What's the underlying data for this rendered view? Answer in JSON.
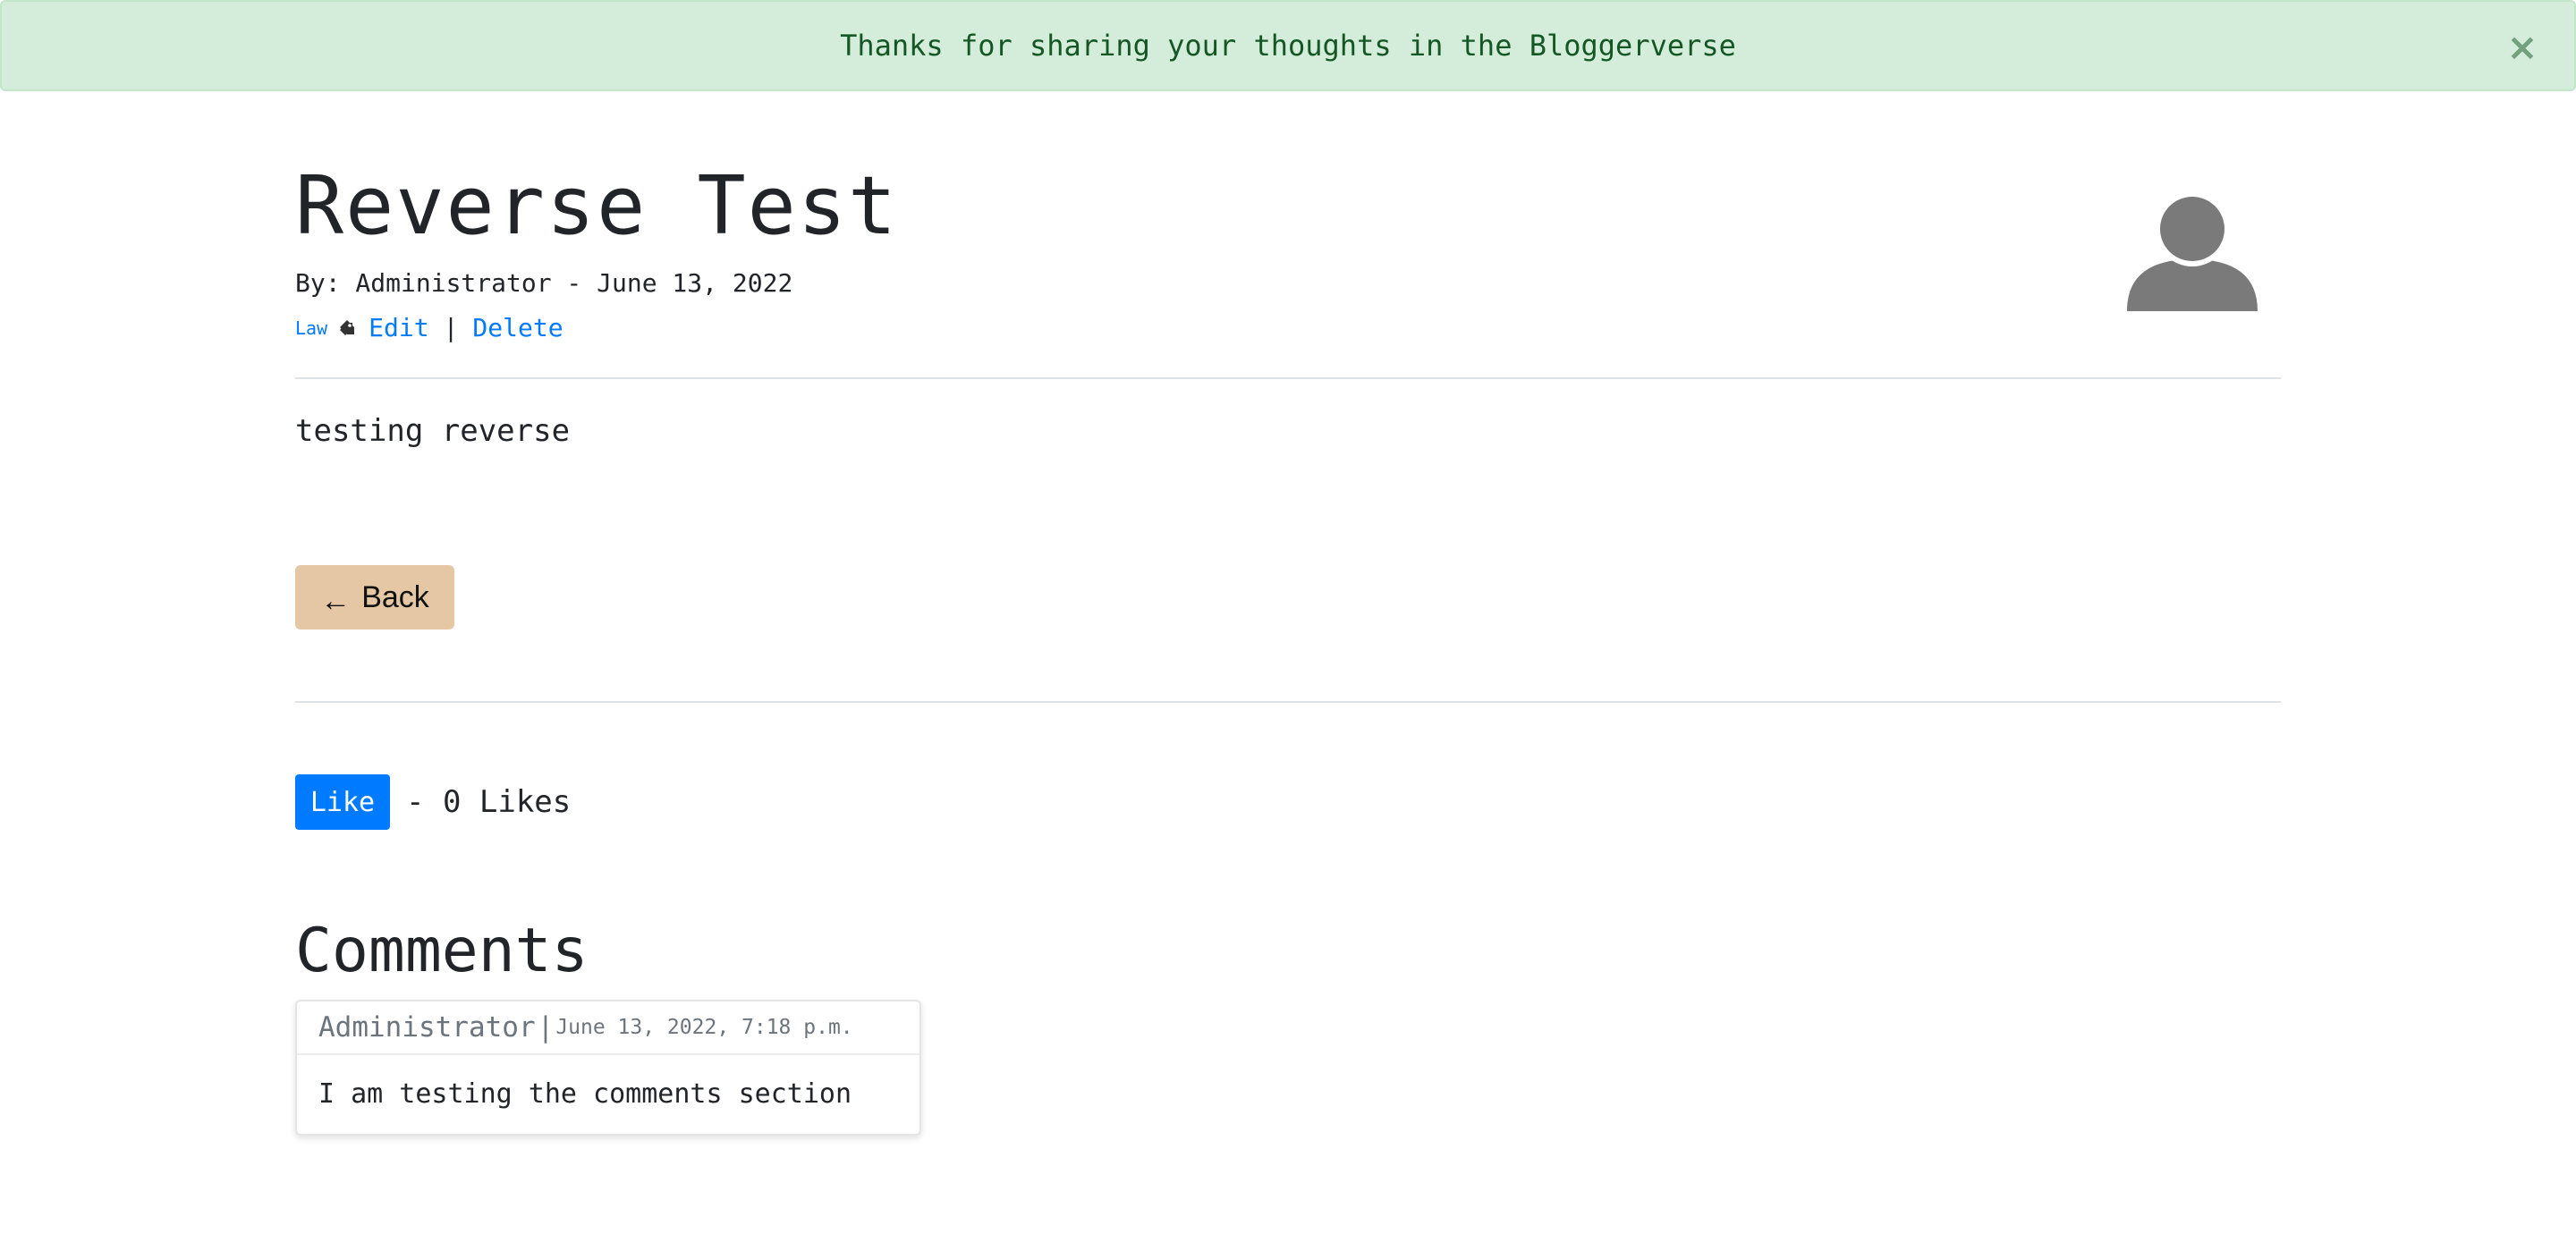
{
  "alert": {
    "message": "Thanks for sharing your thoughts in the Bloggerverse",
    "close_label": "×",
    "color": "#155724",
    "background": "#d4edda"
  },
  "post": {
    "title": "Reverse Test",
    "byline": "By: Administrator - June 13, 2022",
    "category": "Law",
    "edit_label": "Edit",
    "separator": "|",
    "delete_label": "Delete",
    "body": "testing reverse",
    "author_avatar_icon": "user-avatar-icon"
  },
  "back_button": {
    "arrow": "←",
    "label": "Back",
    "color": "#e6c7a5"
  },
  "likes": {
    "button_label": "Like",
    "count_text": "- 0 Likes",
    "color": "#007bff"
  },
  "comments": {
    "heading": "Comments",
    "items": [
      {
        "author": "Administrator",
        "separator": "|",
        "date": "June 13, 2022, 7:18 p.m.",
        "body": "I am testing the comments section"
      }
    ]
  }
}
